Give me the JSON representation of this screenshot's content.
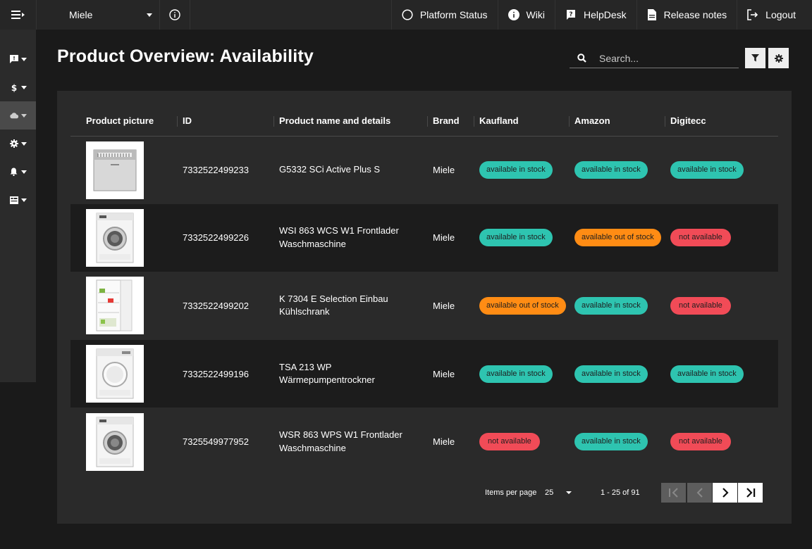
{
  "topbar": {
    "tenant_select": "Miele",
    "links": [
      {
        "label": "Platform Status",
        "icon": "circle-status-icon"
      },
      {
        "label": "Wiki",
        "icon": "info-icon"
      },
      {
        "label": "HelpDesk",
        "icon": "help-icon"
      },
      {
        "label": "Release notes",
        "icon": "document-icon"
      },
      {
        "label": "Logout",
        "icon": "logout-icon"
      }
    ]
  },
  "sidebar": {
    "items": [
      {
        "icon": "feedback-icon",
        "active": false
      },
      {
        "icon": "dollar-icon",
        "active": false
      },
      {
        "icon": "cloud-icon",
        "active": true
      },
      {
        "icon": "gear-icon",
        "active": false
      },
      {
        "icon": "bell-icon",
        "active": false
      },
      {
        "icon": "dashboard-icon",
        "active": false
      }
    ]
  },
  "page": {
    "title": "Product Overview: Availability",
    "search_placeholder": "Search..."
  },
  "table": {
    "headers": [
      "Product picture",
      "ID",
      "Product name and details",
      "Brand",
      "Kaufland",
      "Amazon",
      "Digitecc"
    ],
    "rows": [
      {
        "id": "7332522499233",
        "name": "G5332 SCi Active Plus S",
        "brand": "Miele",
        "kaufland": "available in stock",
        "amazon": "available in stock",
        "digitecc": "available in stock",
        "picture": "dishwasher"
      },
      {
        "id": "7332522499226",
        "name": "WSI 863 WCS W1 Frontlader Waschmaschine",
        "brand": "Miele",
        "kaufland": "available in stock",
        "amazon": "available out of stock",
        "digitecc": "not available",
        "picture": "washer"
      },
      {
        "id": "7332522499202",
        "name": "K 7304 E Selection Einbau Kühlschrank",
        "brand": "Miele",
        "kaufland": "available out of stock",
        "amazon": "available in stock",
        "digitecc": "not available",
        "picture": "fridge"
      },
      {
        "id": "7332522499196",
        "name": "TSA 213 WP Wärmepumpentrockner",
        "brand": "Miele",
        "kaufland": "available in stock",
        "amazon": "available in stock",
        "digitecc": "available in stock",
        "picture": "dryer"
      },
      {
        "id": "7325549977952",
        "name": "WSR 863 WPS W1 Frontlader Waschmaschine",
        "brand": "Miele",
        "kaufland": "not available",
        "amazon": "available in stock",
        "digitecc": "not available",
        "picture": "washer"
      }
    ]
  },
  "pagination": {
    "items_per_page_label": "Items per page",
    "items_per_page": "25",
    "range": "1 - 25 of 91"
  },
  "colors": {
    "in_stock": "#2ec4b0",
    "out_of_stock": "#ff8c14",
    "not_available": "#f14b57"
  }
}
